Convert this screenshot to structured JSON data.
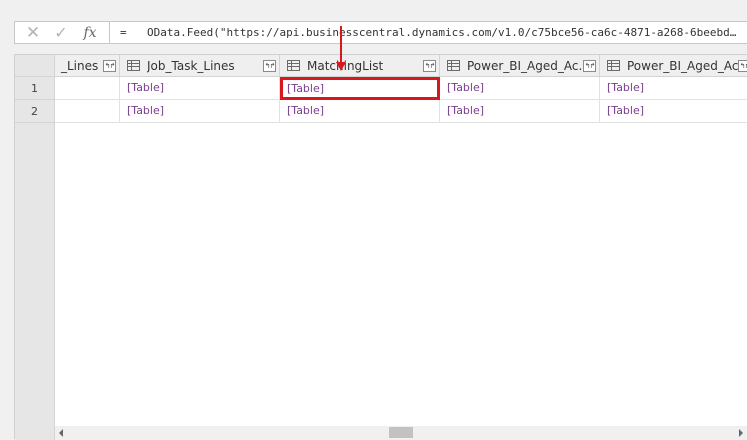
{
  "formula_bar": {
    "cancel_icon": "x-icon",
    "commit_icon": "check-icon",
    "fx_label": "fx",
    "equals": "=",
    "formula": "OData.Feed(\"https://api.businesscentral.dynamics.com/v1.0/c75bce56-ca6c-4871-a268-6beebd…"
  },
  "grid": {
    "columns": [
      {
        "label": "_Lines"
      },
      {
        "label": "Job_Task_Lines"
      },
      {
        "label": "MatchingList"
      },
      {
        "label": "Power_BI_Aged_Ac..."
      },
      {
        "label": "Power_BI_Aged_Ac..."
      }
    ],
    "rows": [
      {
        "num": "1",
        "cells": [
          "",
          "[Table]",
          "[Table]",
          "[Table]",
          "[Table]"
        ]
      },
      {
        "num": "2",
        "cells": [
          "",
          "[Table]",
          "[Table]",
          "[Table]",
          "[Table]"
        ]
      }
    ],
    "highlight": {
      "row": 1,
      "column": "MatchingList"
    }
  },
  "colors": {
    "link": "#7a3f8c",
    "highlight": "#d8181f"
  }
}
